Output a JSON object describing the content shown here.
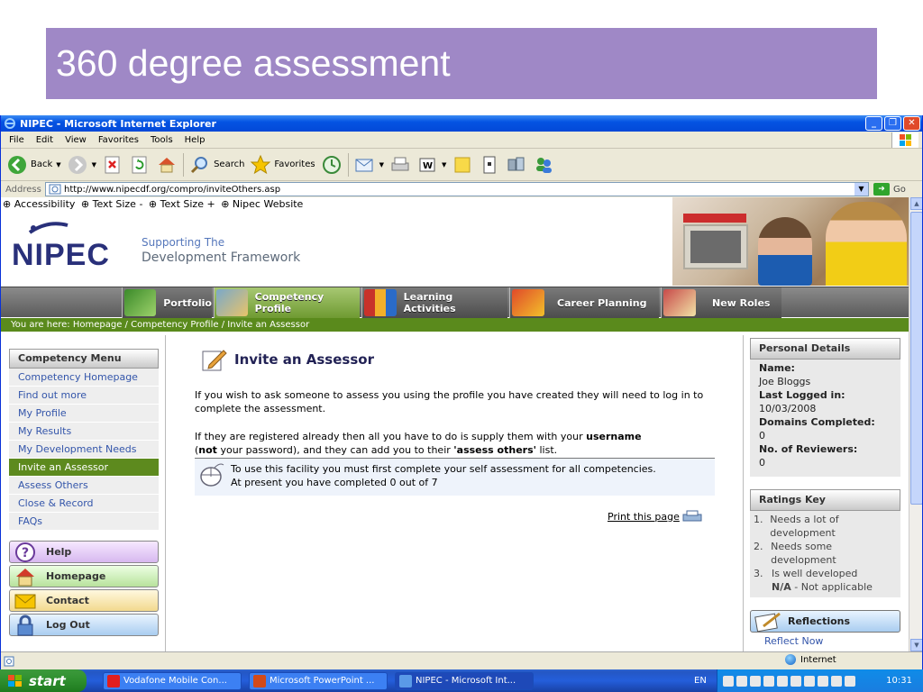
{
  "slide": {
    "title": "360 degree assessment"
  },
  "window": {
    "title": "NIPEC - Microsoft Internet Explorer",
    "menu": [
      "File",
      "Edit",
      "View",
      "Favorites",
      "Tools",
      "Help"
    ],
    "toolbar": {
      "back": "Back",
      "search": "Search",
      "favorites": "Favorites"
    },
    "address_label": "Address",
    "address_value": "http://www.nipecdf.org/compro/inviteOthers.asp",
    "go_label": "Go",
    "status_zone": "Internet"
  },
  "site": {
    "access_links": [
      "⊕ Accessibility",
      "⊕ Text Size -",
      "⊕ Text Size +",
      "⊕ Nipec Website"
    ],
    "logo_text": "NIPEC",
    "tagline_1": "Supporting The",
    "tagline_2": "Development Framework",
    "nav": [
      "Portfolio",
      "Competency Profile",
      "Learning Activities",
      "Career Planning",
      "New Roles"
    ],
    "breadcrumb": "You are here: Homepage / Competency Profile / Invite an Assessor"
  },
  "left_menu": {
    "header": "Competency Menu",
    "items": [
      "Competency Homepage",
      "Find out more",
      "My Profile",
      "My Results",
      "My Development Needs",
      "Invite an Assessor",
      "Assess Others",
      "Close & Record",
      "FAQs"
    ],
    "quick": [
      "Help",
      "Homepage",
      "Contact",
      "Log Out"
    ]
  },
  "main": {
    "title": "Invite an Assessor",
    "para1": "If you wish to ask someone to assess you using the profile you have created they will need to log in to complete the assessment.",
    "para2_a": "If they are registered already then all you have to do is supply them with your ",
    "para2_b": "username",
    "para2_c": "(",
    "para2_d": "not",
    "para2_e": " your password), and they can add you to their ",
    "para2_f": "'assess others'",
    "para2_g": " list.",
    "notice_1": "To use this facility you must first complete your self assessment for all competencies.",
    "notice_2": "At present you have completed 0 out of 7",
    "print": "Print this page"
  },
  "personal": {
    "header": "Personal Details",
    "name_label": "Name:",
    "name": "Joe Bloggs",
    "last_label": "Last Logged in:",
    "last": "10/03/2008",
    "domains_label": "Domains Completed:",
    "domains": "0",
    "reviewers_label": "No. of Reviewers:",
    "reviewers": "0"
  },
  "ratings": {
    "header": "Ratings Key",
    "items": [
      {
        "num": "1.",
        "text": "Needs a lot of development"
      },
      {
        "num": "2.",
        "text": "Needs some development"
      },
      {
        "num": "3.",
        "text": "Is well developed"
      }
    ],
    "na_code": "N/A",
    "na_text": " - Not applicable"
  },
  "reflections": {
    "header": "Reflections",
    "sub": "Reflect Now"
  },
  "taskbar": {
    "start": "start",
    "items": [
      "Vodafone Mobile Con...",
      "Microsoft PowerPoint ...",
      "NIPEC - Microsoft Int..."
    ],
    "lang": "EN",
    "clock": "10:31"
  }
}
